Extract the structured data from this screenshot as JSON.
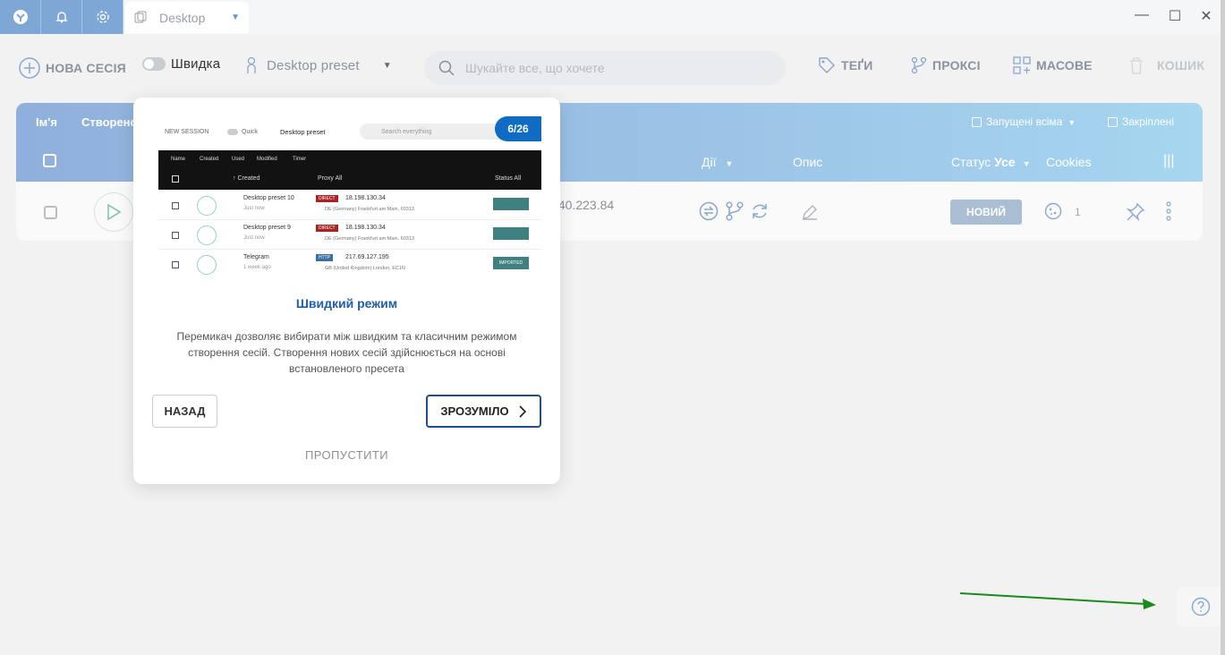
{
  "tab": {
    "title": "Desktop"
  },
  "toolbar": {
    "new_session": "НОВА СЕСІЯ",
    "quick": "Швидка",
    "preset": "Desktop preset",
    "search_placeholder": "Шукайте все, що хочете",
    "tags": "ТЕҐИ",
    "proxy": "ПРОКСІ",
    "bulk": "МАСОВЕ",
    "trash": "КОШИК"
  },
  "table": {
    "header": {
      "name": "Ім'я",
      "created": "Створено",
      "running_all": "Запущені всіма",
      "pinned": "Закріплені",
      "actions": "Дії",
      "description": "Опис",
      "status": "Статус",
      "status_value": "Усе",
      "cookies": "Cookies"
    },
    "row": {
      "ip_partial": ".40.223.84",
      "status": "НОВИЙ",
      "cookie_count": "1"
    }
  },
  "popover": {
    "step": "6/26",
    "title": "Швидкий режим",
    "text": "Перемикач дозволяє вибирати між швидким та класичним режимом створення сесій. Створення нових сесій здійснюється на основі встановленого пресета",
    "back": "НАЗАД",
    "ok": "ЗРОЗУМІЛО",
    "skip": "ПРОПУСТИТИ",
    "preview": {
      "new_session": "NEW SESSION",
      "quick": "Quick",
      "preset": "Desktop preset",
      "search": "Search everything",
      "tabs": [
        "Name",
        "Created",
        "Used",
        "Modified",
        "Timer"
      ],
      "col_created": "↑ Created",
      "col_proxy": "Proxy  All",
      "col_status": "Status  All",
      "rows": [
        {
          "name": "Desktop preset 10",
          "time": "Just now",
          "proxy_type": "DIRECT",
          "ip": "18.198.130.34",
          "loc": "DE (Germany) Frankfurt am Main, 60313",
          "status": ""
        },
        {
          "name": "Desktop preset 9",
          "time": "Just now",
          "proxy_type": "DIRECT",
          "ip": "18.198.130.34",
          "loc": "DE (Germany) Frankfurt am Main, 60313",
          "status": ""
        },
        {
          "name": "Telegram",
          "time": "1 week ago",
          "proxy_type": "HTTP",
          "ip": "217.69.127.195",
          "loc": "GB (United Kingdom) London, EC1N",
          "status": "IMPORTED"
        }
      ]
    }
  },
  "colors": {
    "accent": "#1e5fa8",
    "header_gradient_start": "#8fb0dc",
    "header_gradient_end": "#a6d6f0",
    "arrow": "#1a8a1a"
  }
}
